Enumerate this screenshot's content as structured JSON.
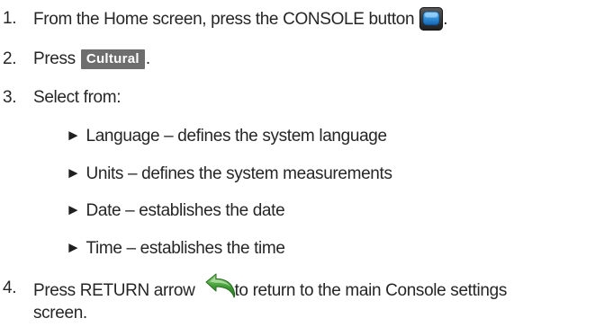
{
  "steps": [
    {
      "number": "1.",
      "text_before": "From the Home screen, press the CONSOLE button",
      "icon": "console-button-icon",
      "text_after": "."
    },
    {
      "number": "2.",
      "text_before": "Press",
      "button_label": "Cultural",
      "text_after": "."
    },
    {
      "number": "3.",
      "text": "Select from:",
      "options": [
        {
          "bullet": "►",
          "text": "Language – defines the system language"
        },
        {
          "bullet": "►",
          "text": "Units – defines the system measurements"
        },
        {
          "bullet": "►",
          "text": "Date – establishes the date"
        },
        {
          "bullet": "►",
          "text": "Time – establishes the time"
        }
      ]
    },
    {
      "number": "4.",
      "text_before": "Press RETURN arrow",
      "icon": "return-arrow-icon",
      "text_after": "to return to the main Console settings",
      "text_continued": "screen."
    }
  ],
  "colors": {
    "text": "#262626",
    "button_background": "#6e6e6e",
    "button_text": "#ffffff",
    "console_icon_blue": "#2f8fd8",
    "return_arrow_green": "#3f9c35"
  }
}
